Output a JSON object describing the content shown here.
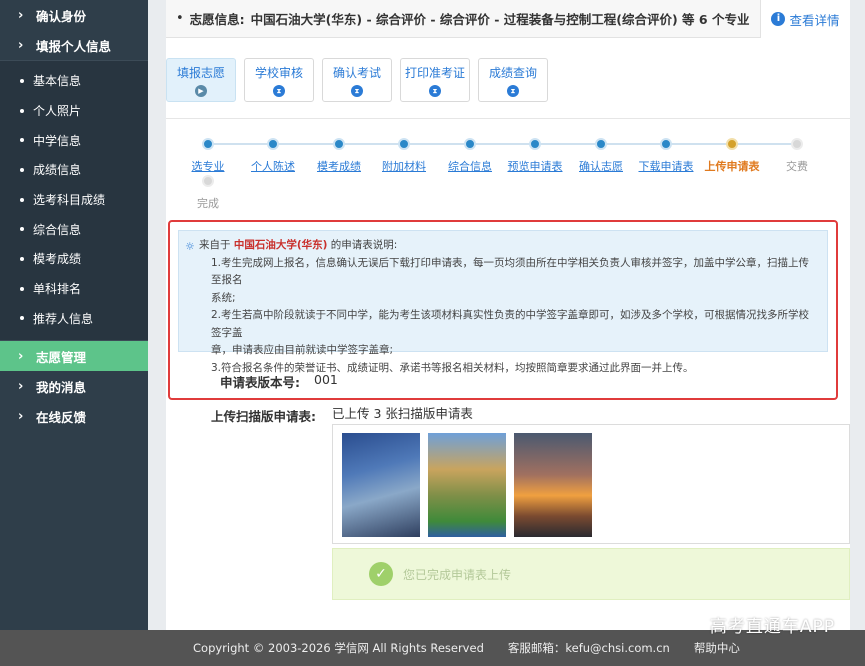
{
  "sidebar": {
    "top_items": [
      {
        "label": "确认身份"
      },
      {
        "label": "填报个人信息"
      }
    ],
    "sub_items": [
      {
        "label": "基本信息"
      },
      {
        "label": "个人照片"
      },
      {
        "label": "中学信息"
      },
      {
        "label": "成绩信息"
      },
      {
        "label": "选考科目成绩"
      },
      {
        "label": "综合信息"
      },
      {
        "label": "模考成绩"
      },
      {
        "label": "单科排名"
      },
      {
        "label": "推荐人信息"
      }
    ],
    "bottom_items": [
      {
        "label": "志愿管理",
        "active": true
      },
      {
        "label": "我的消息"
      },
      {
        "label": "在线反馈"
      }
    ],
    "chevron": "›",
    "active_color": "#5dc48a"
  },
  "info_bar": {
    "label": "志愿信息:",
    "text": "中国石油大学(华东) - 综合评价 - 综合评价 - 过程装备与控制工程(综合评价) 等 6 个专业",
    "details_link": "查看详情"
  },
  "tabs": [
    {
      "label": "填报志愿",
      "active": true
    },
    {
      "label": "学校审核"
    },
    {
      "label": "确认考试"
    },
    {
      "label": "打印准考证"
    },
    {
      "label": "成绩查询"
    }
  ],
  "steps": [
    {
      "label": "选专业",
      "state": "done"
    },
    {
      "label": "个人陈述",
      "state": "done"
    },
    {
      "label": "模考成绩",
      "state": "done"
    },
    {
      "label": "附加材料",
      "state": "done"
    },
    {
      "label": "综合信息",
      "state": "done"
    },
    {
      "label": "预览申请表",
      "state": "done"
    },
    {
      "label": "确认志愿",
      "state": "done"
    },
    {
      "label": "下载申请表",
      "state": "done"
    },
    {
      "label": "上传申请表",
      "state": "current"
    },
    {
      "label": "交费",
      "state": "todo"
    },
    {
      "label": "完成",
      "state": "todo"
    }
  ],
  "notice": {
    "prefix": "来自于",
    "school": "中国石油大学(华东)",
    "suffix": "的申请表说明:",
    "line1": "1.考生完成网上报名，信息确认无误后下载打印申请表，每一页均须由所在中学相关负责人审核并签字，加盖中学公章，扫描上传至报名",
    "line1b": "系统;",
    "line2": "2.考生若高中阶段就读于不同中学，能为考生该项材料真实性负责的中学签字盖章即可，如涉及多个学校，可根据情况找多所学校签字盖",
    "line2b": "章，申请表应由目前就读中学签字盖章;",
    "line3": "3.符合报名条件的荣誉证书、成绩证明、承诺书等报名相关材料，均按照简章要求通过此界面一并上传。"
  },
  "version": {
    "label": "申请表版本号:",
    "value": "001"
  },
  "upload": {
    "label": "上传扫描版申请表:",
    "status": "已上传 3 张扫描版申请表",
    "success_text": "您已完成申请表上传"
  },
  "footer": {
    "copyright": "Copyright © 2003-2026 学信网 All Rights Reserved",
    "email": "客服邮箱：kefu@chsi.com.cn",
    "help": "帮助中心"
  },
  "watermark": "高考直通车APP"
}
